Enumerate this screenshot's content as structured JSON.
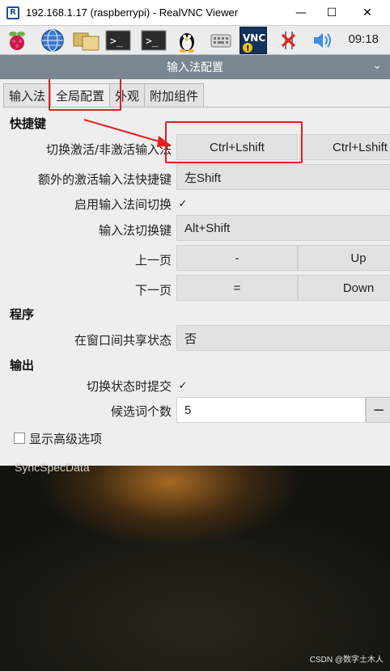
{
  "vnc": {
    "logo": "R",
    "title": "192.168.1.17 (raspberrypi) - RealVNC Viewer",
    "minimize": "—",
    "maximize": "☐",
    "close": "✕"
  },
  "taskbar": {
    "icons": [
      "raspberry-menu-icon",
      "web-browser-icon",
      "file-manager-icon",
      "terminal-icon",
      "terminal-root-icon",
      "linux-penguin-icon",
      "keyboard-icon",
      "vnc-icon",
      "network-disconnected-icon",
      "volume-icon"
    ],
    "vnc_label": "VNC",
    "time": "09:18"
  },
  "dialog": {
    "title": "输入法配置",
    "chevron": "⌄",
    "tabs": [
      {
        "label": "输入法"
      },
      {
        "label": "全局配置"
      },
      {
        "label": "外观"
      },
      {
        "label": "附加组件"
      }
    ],
    "sections": {
      "hotkeys": "快捷键",
      "program": "程序",
      "output": "输出"
    },
    "rows": {
      "toggle_label": "切换激活/非激活输入法",
      "toggle_key1": "Ctrl+Lshift",
      "toggle_key2": "Ctrl+Lshift",
      "extra_label": "额外的激活输入法快捷键",
      "extra_value": "左Shift",
      "enable_switch_label": "启用输入法间切换",
      "enable_switch_check": "✓",
      "switch_key_label": "输入法切换键",
      "switch_key_value": "Alt+Shift",
      "prev_page_label": "上一页",
      "prev_page_key1": "-",
      "prev_page_key2": "Up",
      "next_page_label": "下一页",
      "next_page_key1": "=",
      "next_page_key2": "Down",
      "share_state_label": "在窗口间共享状态",
      "share_state_value": "否",
      "commit_label": "切换状态时提交",
      "commit_check": "✓",
      "candidates_label": "候选词个数",
      "candidates_value": "5",
      "candidates_minus": "−",
      "advanced_label": "显示高级选项"
    }
  },
  "desktop": {
    "text": "SyncSpecData",
    "watermark": "CSDN @数字土木人"
  },
  "colors": {
    "annotation_red": "#e02020",
    "dialog_title_bar": "#7a8792"
  }
}
